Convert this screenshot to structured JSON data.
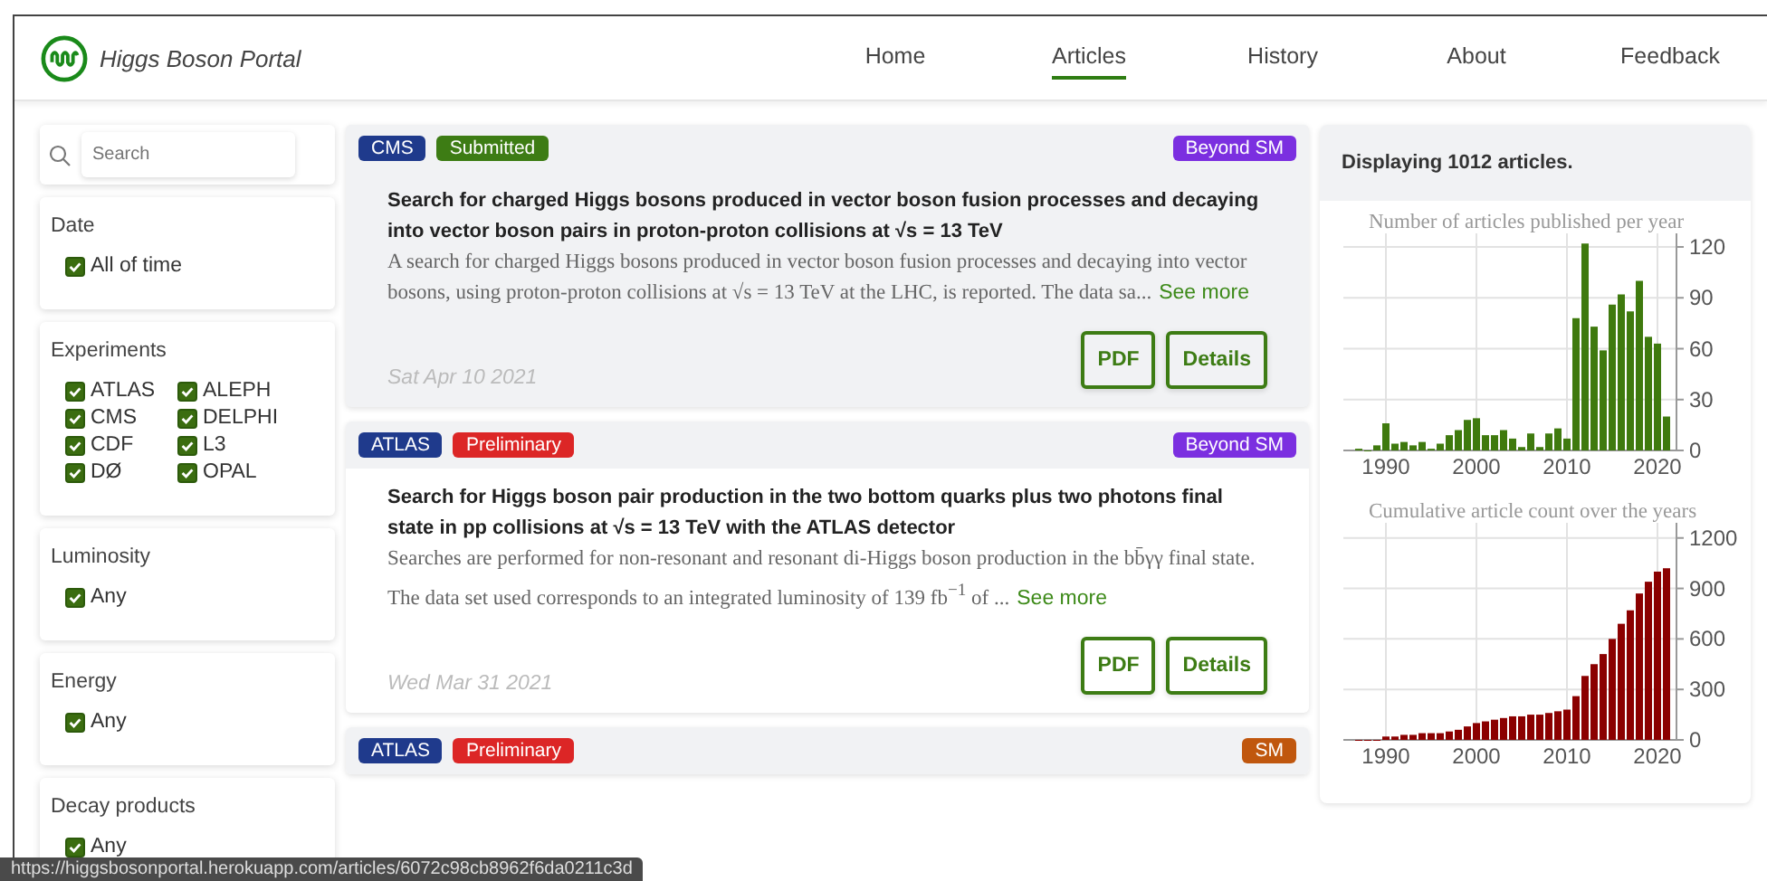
{
  "header": {
    "title": "Higgs Boson Portal",
    "nav": [
      {
        "label": "Home",
        "selected": false
      },
      {
        "label": "Articles",
        "selected": true
      },
      {
        "label": "History",
        "selected": false
      },
      {
        "label": "About",
        "selected": false
      },
      {
        "label": "Feedback",
        "selected": false
      }
    ]
  },
  "sidebar": {
    "search": {
      "placeholder": "Search"
    },
    "filters": [
      {
        "title": "Date",
        "options": [
          {
            "label": "All of time",
            "checked": true
          }
        ]
      },
      {
        "title": "Experiments",
        "options": [
          {
            "label": "ATLAS",
            "checked": true
          },
          {
            "label": "ALEPH",
            "checked": true
          },
          {
            "label": "CMS",
            "checked": true
          },
          {
            "label": "DELPHI",
            "checked": true
          },
          {
            "label": "CDF",
            "checked": true
          },
          {
            "label": "L3",
            "checked": true
          },
          {
            "label": "DØ",
            "checked": true
          },
          {
            "label": "OPAL",
            "checked": true
          }
        ]
      },
      {
        "title": "Luminosity",
        "options": [
          {
            "label": "Any",
            "checked": true
          }
        ]
      },
      {
        "title": "Energy",
        "options": [
          {
            "label": "Any",
            "checked": true
          }
        ]
      },
      {
        "title": "Decay products",
        "options": [
          {
            "label": "Any",
            "checked": true
          }
        ]
      }
    ]
  },
  "articles": [
    {
      "highlighted": true,
      "tags": [
        {
          "label": "CMS",
          "color": "#1f3a8c"
        },
        {
          "label": "Submitted",
          "color": "#3d7c14"
        }
      ],
      "category": {
        "label": "Beyond SM",
        "color": "#7b2fe0"
      },
      "title": "Search for charged Higgs bosons produced in vector boson fusion processes and decaying into vector boson pairs in proton-proton collisions at √s = 13 TeV",
      "abstract": "A search for charged Higgs bosons produced in vector boson fusion processes and decaying into vector bosons, using proton-proton collisions at √s = 13 TeV at the LHC, is reported. The data sa...",
      "more": "See more",
      "date": "Sat Apr 10 2021",
      "buttons": [
        "PDF",
        "Details"
      ]
    },
    {
      "highlighted": false,
      "tags": [
        {
          "label": "ATLAS",
          "color": "#1f3a8c"
        },
        {
          "label": "Preliminary",
          "color": "#dc2626"
        }
      ],
      "category": {
        "label": "Beyond SM",
        "color": "#7b2fe0"
      },
      "title": "Search for Higgs boson pair production in the two bottom quarks plus two photons final state in pp collisions at √s = 13 TeV with the ATLAS detector",
      "abstract": "Searches are performed for non-resonant and resonant di-Higgs boson production in the bb̄γγ final state. The data set used corresponds to an integrated luminosity of 139 fb$^{−1}$ of ...",
      "more": "See more",
      "date": "Wed Mar 31 2021",
      "buttons": [
        "PDF",
        "Details"
      ]
    },
    {
      "tags": [
        {
          "label": "ATLAS",
          "color": "#1f3a8c"
        },
        {
          "label": "Preliminary",
          "color": "#dc2626"
        }
      ],
      "category": {
        "label": "SM",
        "color": "#c0570e"
      }
    }
  ],
  "stats": {
    "summary": "Displaying 1012 articles.",
    "charts": [
      {
        "chart_data": {
          "type": "bar",
          "title": "Number of articles published per year",
          "x": [
            1987,
            1988,
            1989,
            1990,
            1991,
            1992,
            1993,
            1994,
            1995,
            1996,
            1997,
            1998,
            1999,
            2000,
            2001,
            2002,
            2003,
            2004,
            2005,
            2006,
            2007,
            2008,
            2009,
            2010,
            2011,
            2012,
            2013,
            2014,
            2015,
            2016,
            2017,
            2018,
            2019,
            2020,
            2021
          ],
          "grid": true,
          "series": [
            {
              "color": "#3f7a0e",
              "values": [
                1,
                0,
                3,
                16,
                4,
                5,
                3,
                5,
                1,
                4,
                9,
                12,
                18,
                19,
                9,
                9,
                12,
                7,
                2,
                10,
                2,
                10,
                13,
                7,
                78,
                122,
                73,
                59,
                86,
                92,
                82,
                100,
                67,
                63,
                20
              ]
            }
          ],
          "xlim": [
            1985.3,
            2022.1
          ],
          "ylim": [
            0,
            128
          ],
          "xticks": [
            1990,
            2000,
            2010,
            2020
          ],
          "yticks": [
            0,
            30,
            60,
            90,
            120
          ]
        }
      },
      {
        "chart_data": {
          "type": "bar",
          "title": "Cumulative article count over the years",
          "x": [
            1987,
            1988,
            1989,
            1990,
            1991,
            1992,
            1993,
            1994,
            1995,
            1996,
            1997,
            1998,
            1999,
            2000,
            2001,
            2002,
            2003,
            2004,
            2005,
            2006,
            2007,
            2008,
            2009,
            2010,
            2011,
            2012,
            2013,
            2014,
            2015,
            2016,
            2017,
            2018,
            2019,
            2020,
            2021
          ],
          "grid": true,
          "series": [
            {
              "color": "#8b0000",
              "values": [
                0,
                0,
                0,
                20,
                20,
                30,
                30,
                40,
                40,
                40,
                50,
                60,
                80,
                100,
                110,
                120,
                130,
                140,
                140,
                150,
                150,
                160,
                170,
                180,
                260,
                380,
                450,
                510,
                600,
                690,
                770,
                870,
                940,
                1000,
                1020
              ]
            }
          ],
          "xlim": [
            1985.3,
            2022.1
          ],
          "ylim": [
            0,
            1290
          ],
          "xticks": [
            1990,
            2000,
            2010,
            2020
          ],
          "yticks": [
            0,
            300,
            600,
            900,
            1200
          ]
        }
      }
    ]
  },
  "status_bar": {
    "url": "https://higgsbosonportal.herokuapp.com/articles/6072c98cb8962f6da0211c3d"
  }
}
